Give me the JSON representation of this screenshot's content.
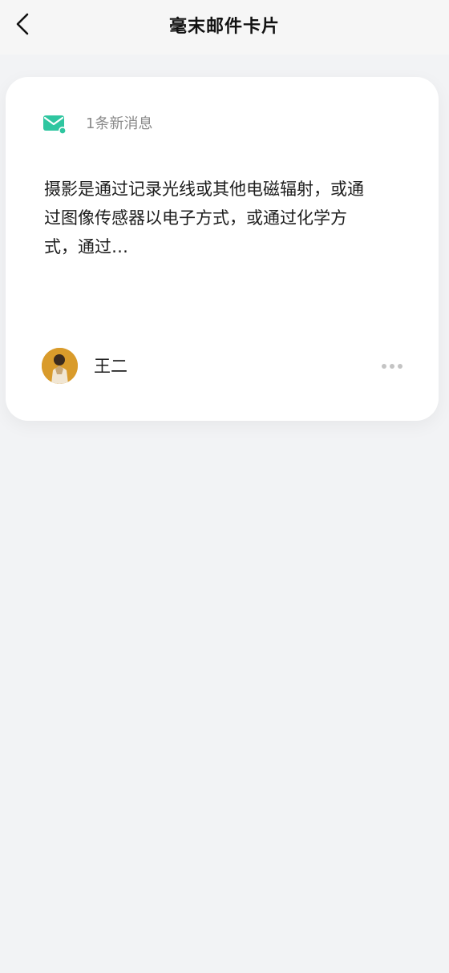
{
  "nav": {
    "back_icon": "chevron-left-icon",
    "title": "毫末邮件卡片"
  },
  "card": {
    "mail_icon": "mail-icon",
    "accent_color": "#2fc6a0",
    "new_count": "1条新消息",
    "body_lines": [
      "摄影是通过记录光线或其他电磁辐射，或通",
      "过图像传感器以电子方式，或通过化学方",
      "式，通过…"
    ],
    "sender": {
      "avatar_icon": "avatar",
      "name": "王二"
    },
    "more_icon": "more-horizontal-icon"
  }
}
